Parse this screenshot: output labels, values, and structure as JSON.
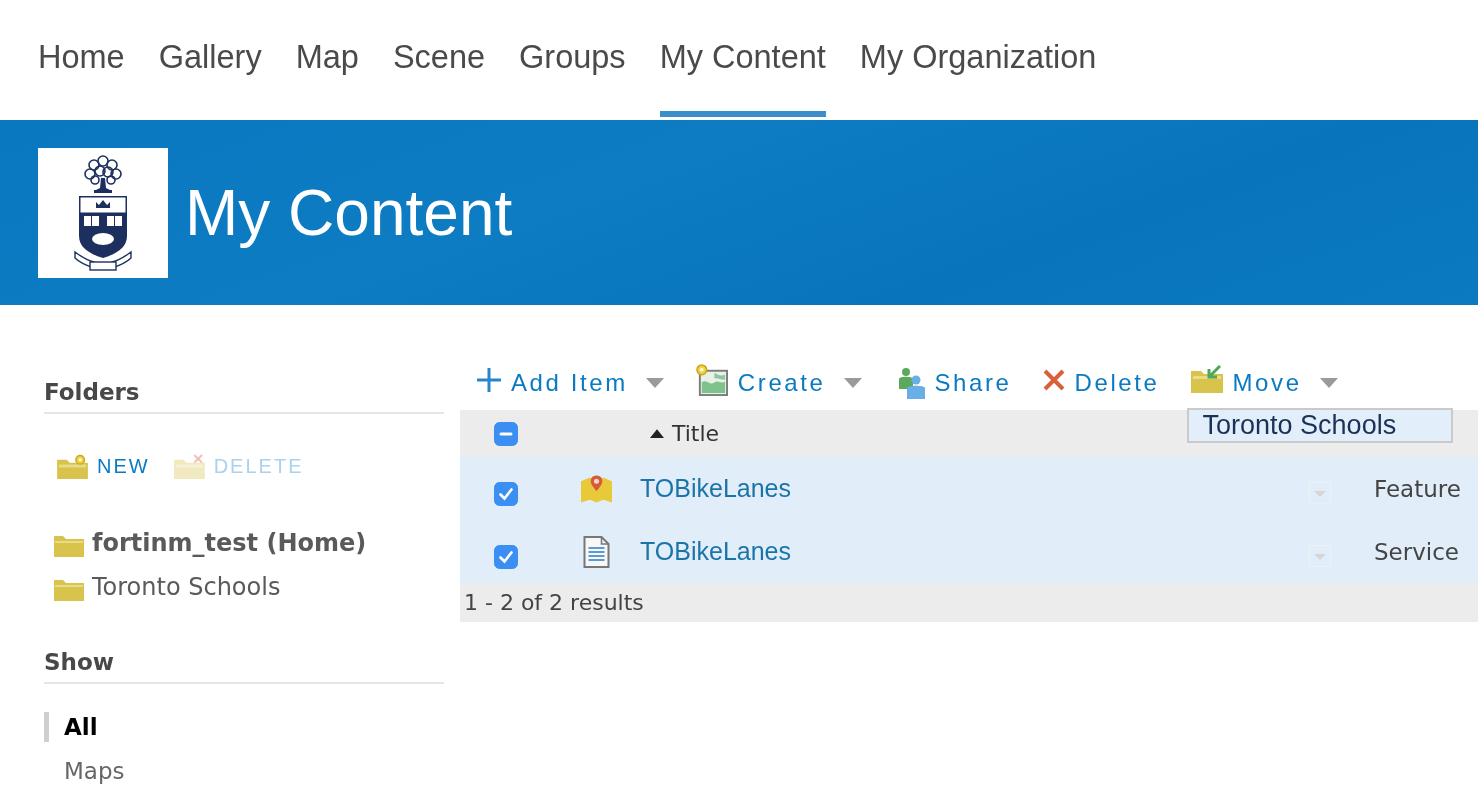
{
  "nav": {
    "tabs": [
      {
        "label": "Home",
        "selected": false
      },
      {
        "label": "Gallery",
        "selected": false
      },
      {
        "label": "Map",
        "selected": false
      },
      {
        "label": "Scene",
        "selected": false
      },
      {
        "label": "Groups",
        "selected": false
      },
      {
        "label": "My Content",
        "selected": true
      },
      {
        "label": "My Organization",
        "selected": false
      }
    ]
  },
  "banner": {
    "title": "My Content"
  },
  "sidebar": {
    "folders_heading": "Folders",
    "folder_actions": [
      {
        "kind": "new",
        "label": "NEW",
        "disabled": false
      },
      {
        "kind": "delete",
        "label": "DELETE",
        "disabled": true
      }
    ],
    "folders": [
      {
        "name": "fortinm_test (Home)",
        "selected": true
      },
      {
        "name": "Toronto Schools",
        "selected": false
      }
    ],
    "show_heading": "Show",
    "filters": [
      {
        "label": "All",
        "selected": true
      },
      {
        "label": "Maps",
        "selected": false
      }
    ]
  },
  "toolbar": {
    "actions": [
      {
        "kind": "add",
        "label": "Add Item",
        "has_menu": true
      },
      {
        "kind": "create",
        "label": "Create",
        "has_menu": true
      },
      {
        "kind": "share",
        "label": "Share",
        "has_menu": false
      },
      {
        "kind": "delete",
        "label": "Delete",
        "has_menu": false
      },
      {
        "kind": "move",
        "label": "Move",
        "has_menu": true
      }
    ]
  },
  "move_menu": {
    "items": [
      {
        "label": "Toronto Schools",
        "highlighted": true
      }
    ]
  },
  "table": {
    "select_all": {
      "checked": false,
      "partial": true
    },
    "columns": [
      {
        "label": "Title",
        "sort_ascending": true
      }
    ],
    "rows": [
      {
        "kind": "feature-layer",
        "checked": true,
        "title": "TOBikeLanes",
        "type": "Feature"
      },
      {
        "kind": "service-definition",
        "checked": true,
        "title": "TOBikeLanes",
        "type": "Service"
      }
    ]
  },
  "footer": {
    "results": "1 - 2 of 2 results"
  }
}
